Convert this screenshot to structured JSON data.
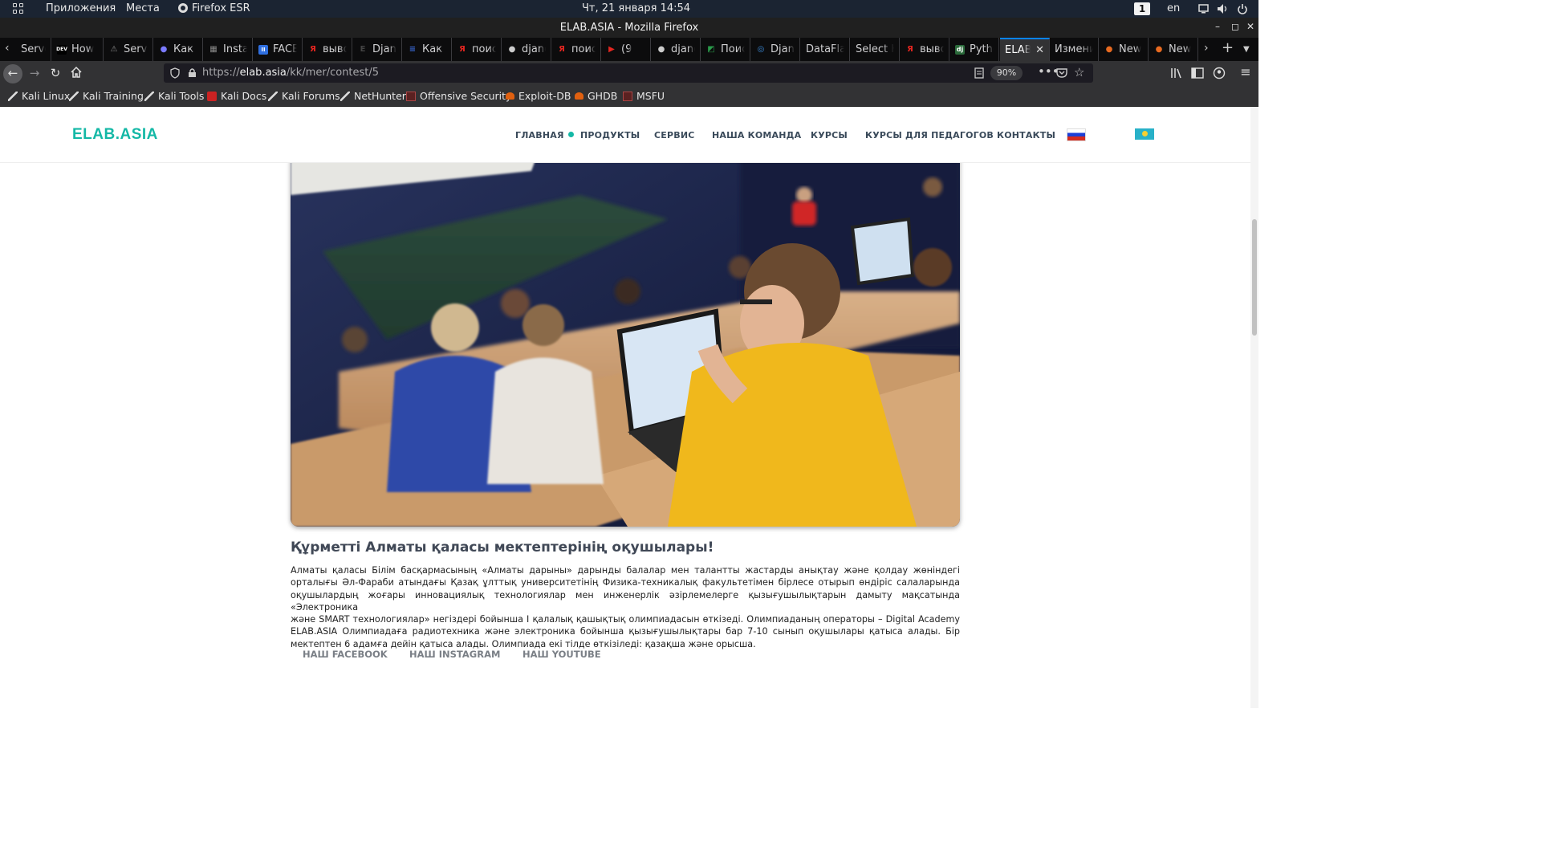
{
  "system_bar": {
    "applications": "Приложения",
    "places": "Места",
    "app_name": "Firefox ESR",
    "clock": "Чт, 21 января  14:54",
    "workspace": "1",
    "keyboard_layout": "en"
  },
  "window": {
    "title": "ELAB.ASIA - Mozilla Firefox"
  },
  "tabs": [
    {
      "label": "Server",
      "favicon": "none",
      "color": "#888888"
    },
    {
      "label": "How",
      "favicon": "dev-icon",
      "color": "#000000"
    },
    {
      "label": "Server",
      "favicon": "warning-icon",
      "color": "#888888"
    },
    {
      "label": "Как г",
      "favicon": "chat-icon",
      "color": "#7a7aff"
    },
    {
      "label": "Insta",
      "favicon": "table-icon",
      "color": "#888888"
    },
    {
      "label": "FACE",
      "favicon": "pause-icon",
      "color": "#2f6fe0"
    },
    {
      "label": "выво",
      "favicon": "yandex-icon",
      "color": "#e52620"
    },
    {
      "label": "Djang",
      "favicon": "e-icon",
      "color": "#444444"
    },
    {
      "label": "Как е",
      "favicon": "stack-icon",
      "color": "#3a6ad8"
    },
    {
      "label": "поис",
      "favicon": "yandex-icon",
      "color": "#e52620"
    },
    {
      "label": "djang",
      "favicon": "github-icon",
      "color": "#cccccc"
    },
    {
      "label": "поис",
      "favicon": "yandex-icon",
      "color": "#e52620"
    },
    {
      "label": "(9",
      "favicon": "youtube-icon",
      "color": "#e52620"
    },
    {
      "label": "djang",
      "favicon": "github-icon",
      "color": "#cccccc"
    },
    {
      "label": "Поис",
      "favicon": "image-icon",
      "color": "#2a9a4a"
    },
    {
      "label": "Djang",
      "favicon": "compass-icon",
      "color": "#3a8ad8"
    },
    {
      "label": "DataFlai",
      "favicon": "none",
      "color": "#888888"
    },
    {
      "label": "Select K",
      "favicon": "none",
      "color": "#888888"
    },
    {
      "label": "выво",
      "favicon": "yandex-icon",
      "color": "#e52620"
    },
    {
      "label": "Pytho",
      "favicon": "django-icon",
      "color": "#2a6a3a"
    },
    {
      "label": "ELAB.A",
      "favicon": "none",
      "color": "#888888",
      "active": true
    },
    {
      "label": "Измени",
      "favicon": "none",
      "color": "#888888"
    },
    {
      "label": "New",
      "favicon": "firefox-icon",
      "color": "#e86a20"
    },
    {
      "label": "New",
      "favicon": "firefox-icon",
      "color": "#e86a20"
    }
  ],
  "navbar": {
    "url_prefix": "https://",
    "url_domain": "elab.asia",
    "url_path": "/kk/mer/contest/5",
    "zoom": "90%"
  },
  "bookmarks": [
    {
      "label": "Kali Linux",
      "icon": "kali-icon"
    },
    {
      "label": "Kali Training",
      "icon": "kali-icon"
    },
    {
      "label": "Kali Tools",
      "icon": "kali-icon"
    },
    {
      "label": "Kali Docs",
      "icon": "kali-docs-icon"
    },
    {
      "label": "Kali Forums",
      "icon": "kali-icon"
    },
    {
      "label": "NetHunter",
      "icon": "kali-icon"
    },
    {
      "label": "Offensive Security",
      "icon": "offsec-icon"
    },
    {
      "label": "Exploit-DB",
      "icon": "exploitdb-icon"
    },
    {
      "label": "GHDB",
      "icon": "exploitdb-icon"
    },
    {
      "label": "MSFU",
      "icon": "offsec-icon"
    }
  ],
  "site": {
    "logo": "ELAB.ASIA",
    "menu": [
      "ГЛАВНАЯ",
      "ПРОДУКТЫ",
      "СЕРВИС",
      "НАША КОМАНДА",
      "КУРСЫ",
      "КУРСЫ ДЛЯ ПЕДАГОГОВ",
      "КОНТАКТЫ"
    ],
    "accent_color": "#14b8a6",
    "heading": "Құрметті Алматы қаласы мектептерінің оқушылары!",
    "body_lines": [
      "Алматы қаласы Білім басқармасының «Алматы дарыны» дарынды балалар мен талантты жастарды анықтау және қолдау жөніндегі",
      "орталығы Әл-Фараби атындағы Қазақ ұлттық университетінің Физика-техникалық факультетімен бірлесе отырып өндіріс салаларында",
      "оқушылардың жоғары инновациялық технологиялар мен инженерлік әзірлемелерге қызығушылықтарын дамыту мақсатында «Электроника",
      "және SMART технологиялар» негіздері бойынша I қалалық қашықтық олимпиадасын өткізеді. Олимпиаданың операторы – Digital Academy",
      "ELAB.ASIA Олимпиадаға радиотехника және электроника бойынша қызығушылықтары бар 7-10 сынып оқушылары қатыса алады. Бір",
      "мектептен 6 адамға дейін қатыса алады. Олимпиада екі тілде өткізіледі: қазақша және орысша."
    ],
    "social_links": [
      "НАШ FACEBOOK",
      "НАШ INSTAGRAM",
      "НАШ YOUTUBE"
    ]
  }
}
